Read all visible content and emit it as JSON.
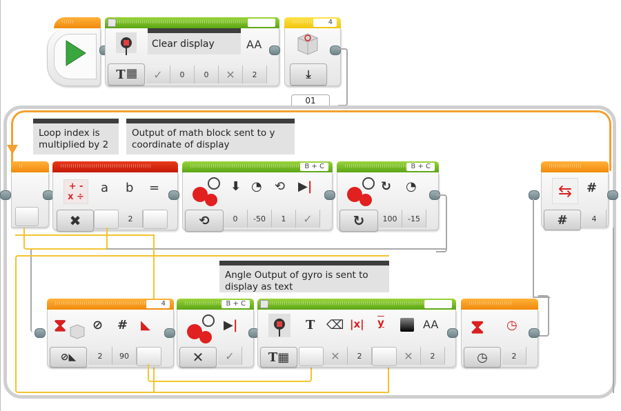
{
  "program": {
    "start_block": {
      "icon": "play-icon"
    },
    "display_clear_block": {
      "port_label": "",
      "mode_icon": "text-grid-icon",
      "comment": "Clear display",
      "inputs": [
        {
          "name": "clear-screen",
          "value": "✓"
        },
        {
          "name": "x",
          "value": "0"
        },
        {
          "name": "y",
          "value": "0"
        },
        {
          "name": "color",
          "value": "✕"
        },
        {
          "name": "font",
          "value": "2"
        }
      ],
      "font_label": "AA"
    },
    "gyro_reset_block": {
      "port": "4",
      "mode_icon": "reset-icon"
    },
    "loop": {
      "name": "01",
      "mode_icon": "count-icon",
      "count_label": "#",
      "count": "4"
    },
    "comments": [
      {
        "text": "Loop index is multiplied by 2"
      },
      {
        "text": "Output of math block sent to y coordinate of display"
      },
      {
        "text": "Angle Output of gyro is sent to display as text"
      }
    ],
    "math_block": {
      "mode_icon": "multiply-icon",
      "labels": [
        "a",
        "b",
        "="
      ],
      "inputs": [
        {
          "name": "a",
          "value": ""
        },
        {
          "name": "b",
          "value": "2"
        },
        {
          "name": "result",
          "value": ""
        }
      ]
    },
    "steering_block_1": {
      "ports": "B + C",
      "mode_icon": "rotations-icon",
      "inputs": [
        {
          "name": "steering",
          "value": "0"
        },
        {
          "name": "power",
          "value": "-50"
        },
        {
          "name": "rotations",
          "value": "1"
        },
        {
          "name": "brake",
          "value": "✓"
        }
      ]
    },
    "steering_block_2": {
      "ports": "B + C",
      "mode_icon": "on-icon",
      "inputs": [
        {
          "name": "steering",
          "value": "100"
        },
        {
          "name": "power",
          "value": "-15"
        }
      ]
    },
    "wait_gyro_block": {
      "port": "4",
      "mode_icon": "gyro-angle-change-icon",
      "labels": [
        "",
        "#",
        ""
      ],
      "inputs": [
        {
          "name": "direction",
          "value": "2"
        },
        {
          "name": "amount",
          "value": "90"
        },
        {
          "name": "measured",
          "value": ""
        }
      ]
    },
    "steering_off_block": {
      "ports": "B + C",
      "mode_icon": "off-icon",
      "inputs": [
        {
          "name": "brake",
          "value": "✓"
        }
      ]
    },
    "display_text_block": {
      "port_label": "",
      "mode_icon": "text-grid-icon",
      "labels": [
        "T",
        "",
        "|x|",
        "y",
        "",
        "AA"
      ],
      "inputs": [
        {
          "name": "text",
          "value": ""
        },
        {
          "name": "clear-screen",
          "value": "✕"
        },
        {
          "name": "column",
          "value": "2"
        },
        {
          "name": "row",
          "value": ""
        },
        {
          "name": "color",
          "value": "✕"
        },
        {
          "name": "font",
          "value": "2"
        }
      ]
    },
    "wait_time_block": {
      "mode_icon": "timer-icon",
      "inputs": [
        {
          "name": "seconds",
          "value": "2"
        }
      ]
    }
  }
}
